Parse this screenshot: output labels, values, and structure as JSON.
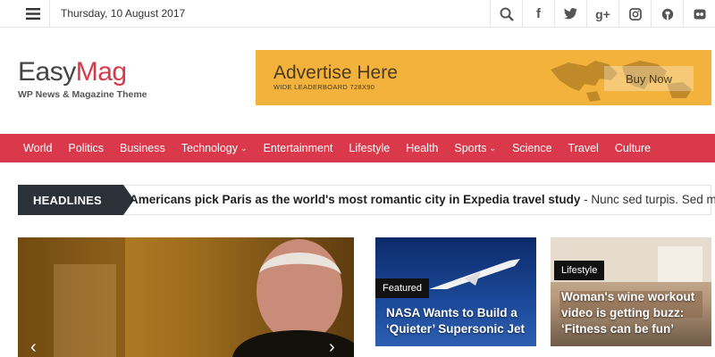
{
  "topbar": {
    "date": "Thursday, 10 August 2017",
    "social_icons": [
      "search-icon",
      "facebook-icon",
      "twitter-icon",
      "google-plus-icon",
      "instagram-icon",
      "github-icon",
      "flickr-icon"
    ]
  },
  "header": {
    "logo_easy": "Easy",
    "logo_mag": "Mag",
    "tagline": "WP News & Magazine Theme",
    "ad": {
      "title": "Advertise Here",
      "subtitle": "WIDE LEADERBOARD 728X90",
      "button": "Buy Now"
    }
  },
  "nav": {
    "items": [
      {
        "label": "World"
      },
      {
        "label": "Politics"
      },
      {
        "label": "Business"
      },
      {
        "label": "Technology",
        "dropdown": true
      },
      {
        "label": "Entertainment"
      },
      {
        "label": "Lifestyle"
      },
      {
        "label": "Health"
      },
      {
        "label": "Sports",
        "dropdown": true
      },
      {
        "label": "Science"
      },
      {
        "label": "Travel"
      },
      {
        "label": "Culture"
      }
    ]
  },
  "ticker": {
    "label": "HEADLINES",
    "headline": "Americans pick Paris as the world's most romantic city in Expedia travel study",
    "excerpt": " - Nunc sed turpis. Sed mollis,"
  },
  "cards": {
    "hero": {
      "prev": "‹",
      "next": "›"
    },
    "card2": {
      "badge": "Featured",
      "title_line1": "NASA Wants to Build a",
      "title_line2": "‘Quieter’ Supersonic Jet"
    },
    "card3": {
      "badge": "Lifestyle",
      "title_line1": "Woman's wine workout",
      "title_line2": "video is getting buzz:",
      "title_line3": "‘Fitness can be fun’"
    }
  },
  "colors": {
    "accent": "#d9394a",
    "dark": "#2c3038",
    "ad_bg": "#f2b23c"
  }
}
